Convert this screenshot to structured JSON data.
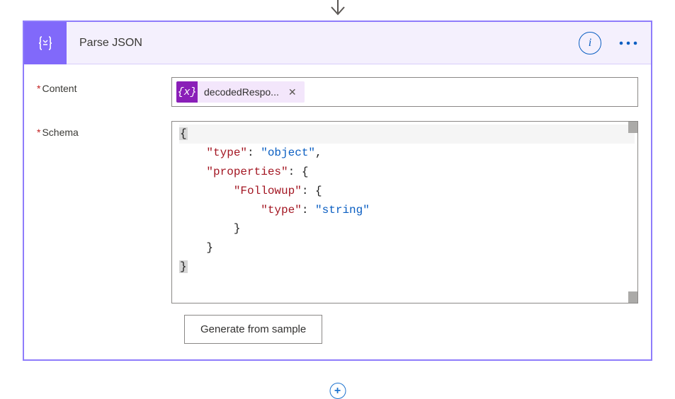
{
  "action": {
    "icon_glyph": "{o}",
    "title": "Parse JSON"
  },
  "fields": {
    "content": {
      "label": "Content",
      "required": true,
      "token": {
        "icon_glyph": "{x}",
        "text": "decodedRespo..."
      }
    },
    "schema": {
      "label": "Schema",
      "required": true,
      "lines": [
        {
          "indent": 0,
          "parts": [
            {
              "t": "brace-cur",
              "v": "{"
            }
          ]
        },
        {
          "indent": 1,
          "parts": [
            {
              "t": "key",
              "v": "\"type\""
            },
            {
              "t": "punct",
              "v": ": "
            },
            {
              "t": "str",
              "v": "\"object\""
            },
            {
              "t": "punct",
              "v": ","
            }
          ]
        },
        {
          "indent": 1,
          "parts": [
            {
              "t": "key",
              "v": "\"properties\""
            },
            {
              "t": "punct",
              "v": ": "
            },
            {
              "t": "brace",
              "v": "{"
            }
          ]
        },
        {
          "indent": 2,
          "parts": [
            {
              "t": "key",
              "v": "\"Followup\""
            },
            {
              "t": "punct",
              "v": ": "
            },
            {
              "t": "brace",
              "v": "{"
            }
          ]
        },
        {
          "indent": 3,
          "parts": [
            {
              "t": "key",
              "v": "\"type\""
            },
            {
              "t": "punct",
              "v": ": "
            },
            {
              "t": "str",
              "v": "\"string\""
            }
          ]
        },
        {
          "indent": 2,
          "parts": [
            {
              "t": "brace",
              "v": "}"
            }
          ]
        },
        {
          "indent": 1,
          "parts": [
            {
              "t": "brace",
              "v": "}"
            }
          ]
        },
        {
          "indent": 0,
          "parts": [
            {
              "t": "brace-cur",
              "v": "}"
            }
          ]
        }
      ]
    }
  },
  "buttons": {
    "generate": "Generate from sample"
  }
}
